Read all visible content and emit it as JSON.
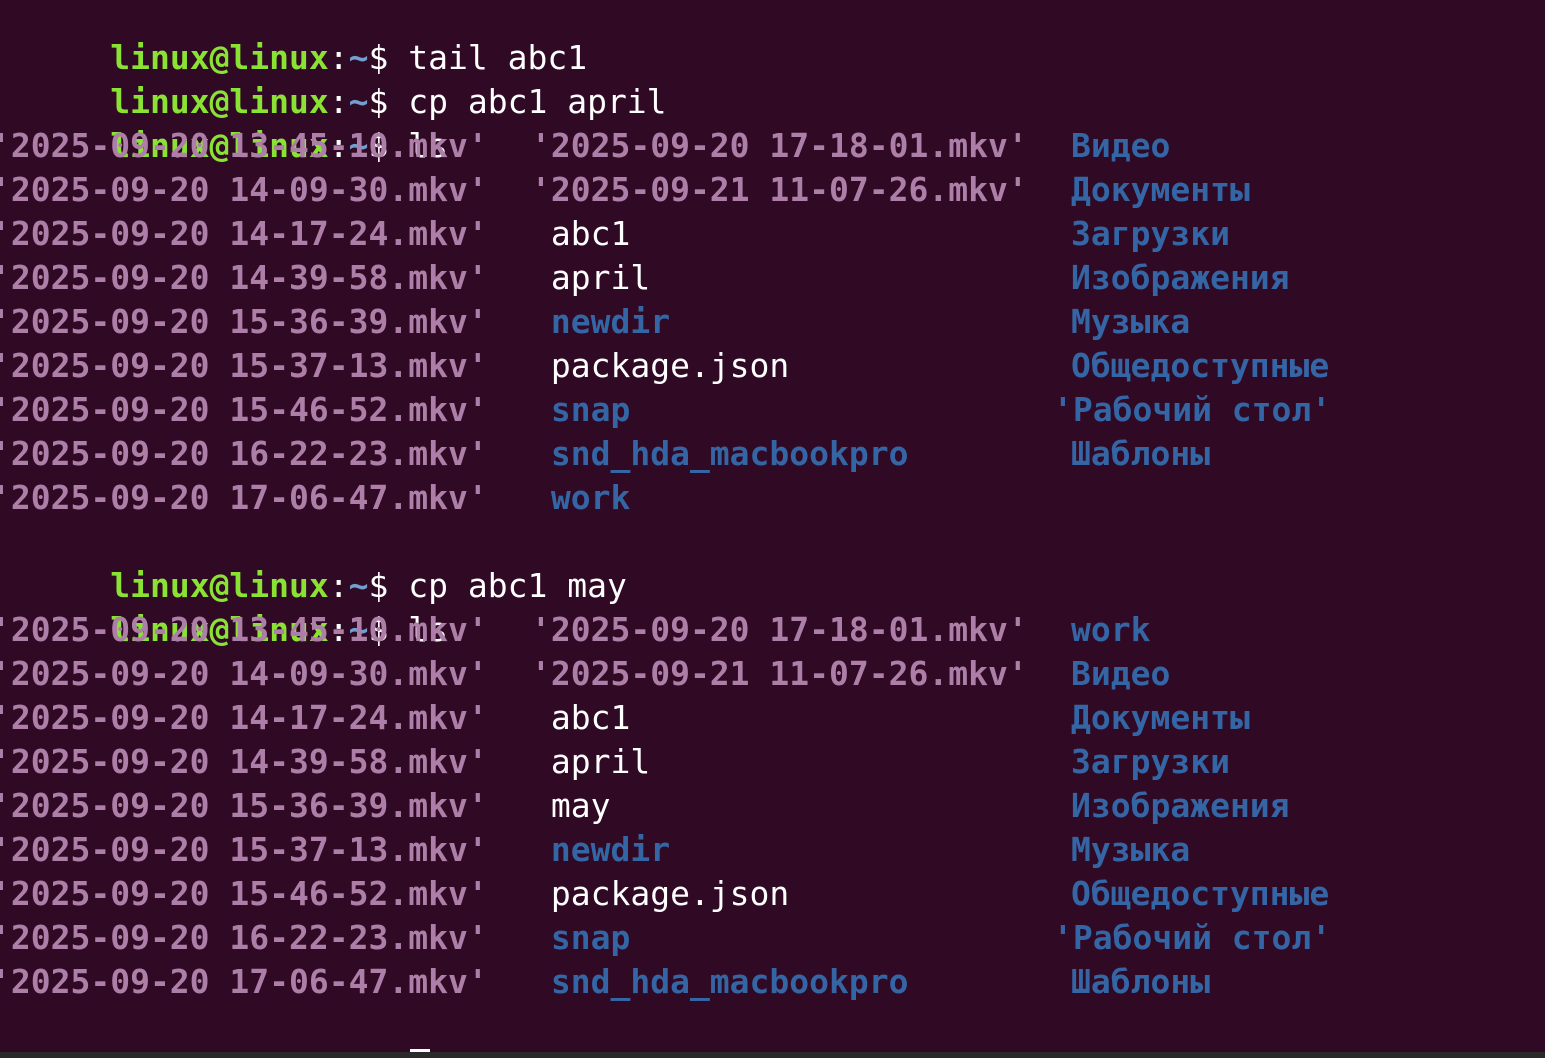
{
  "prompt": {
    "user_host": "linux@linux",
    "colon": ":",
    "path": "~",
    "dollar": "$ "
  },
  "commands": {
    "c1": "tail abc1",
    "c2": "cp abc1 april",
    "c3": "ls",
    "c4": "cp abc1 may",
    "c5": "ls"
  },
  "ls1": [
    [
      "'2025-09-20 13-45-10.mkv'",
      "'2025-09-20 17-18-01.mkv'",
      "Видео"
    ],
    [
      "'2025-09-20 14-09-30.mkv'",
      "'2025-09-21 11-07-26.mkv'",
      "Документы"
    ],
    [
      "'2025-09-20 14-17-24.mkv'",
      " abc1",
      "Загрузки"
    ],
    [
      "'2025-09-20 14-39-58.mkv'",
      " april",
      "Изображения"
    ],
    [
      "'2025-09-20 15-36-39.mkv'",
      " newdir",
      "Музыка"
    ],
    [
      "'2025-09-20 15-37-13.mkv'",
      " package.json",
      "Общедоступные"
    ],
    [
      "'2025-09-20 15-46-52.mkv'",
      " snap",
      "'Рабочий стол'"
    ],
    [
      "'2025-09-20 16-22-23.mkv'",
      " snd_hda_macbookpro",
      "Шаблоны"
    ],
    [
      "'2025-09-20 17-06-47.mkv'",
      " work",
      ""
    ]
  ],
  "ls2": [
    [
      "'2025-09-20 13-45-10.mkv'",
      "'2025-09-20 17-18-01.mkv'",
      "work"
    ],
    [
      "'2025-09-20 14-09-30.mkv'",
      "'2025-09-21 11-07-26.mkv'",
      "Видео"
    ],
    [
      "'2025-09-20 14-17-24.mkv'",
      " abc1",
      "Документы"
    ],
    [
      "'2025-09-20 14-39-58.mkv'",
      " april",
      "Загрузки"
    ],
    [
      "'2025-09-20 15-36-39.mkv'",
      " may",
      "Изображения"
    ],
    [
      "'2025-09-20 15-37-13.mkv'",
      " newdir",
      "Музыка"
    ],
    [
      "'2025-09-20 15-46-52.mkv'",
      " package.json",
      "Общедоступные"
    ],
    [
      "'2025-09-20 16-22-23.mkv'",
      " snap",
      "'Рабочий стол'"
    ],
    [
      "'2025-09-20 17-06-47.mkv'",
      " snd_hda_macbookpro",
      "Шаблоны"
    ]
  ],
  "kinds1": [
    [
      "media",
      "media",
      "dir"
    ],
    [
      "media",
      "media",
      "dir"
    ],
    [
      "media",
      "file",
      "dir"
    ],
    [
      "media",
      "file",
      "dir"
    ],
    [
      "media",
      "dir",
      "dir"
    ],
    [
      "media",
      "file",
      "dir"
    ],
    [
      "media",
      "dir",
      "dir"
    ],
    [
      "media",
      "dir",
      "dir"
    ],
    [
      "media",
      "dir",
      ""
    ]
  ],
  "kinds2": [
    [
      "media",
      "media",
      "dir"
    ],
    [
      "media",
      "media",
      "dir"
    ],
    [
      "media",
      "file",
      "dir"
    ],
    [
      "media",
      "file",
      "dir"
    ],
    [
      "media",
      "file",
      "dir"
    ],
    [
      "media",
      "dir",
      "dir"
    ],
    [
      "media",
      "file",
      "dir"
    ],
    [
      "media",
      "dir",
      "dir"
    ],
    [
      "media",
      "dir",
      "dir"
    ]
  ],
  "colors": {
    "background": "#300a24",
    "prompt_user": "#8ae234",
    "prompt_path": "#729fcf",
    "media_file": "#ad7fa8",
    "directory": "#3465a4",
    "regular_file": "#ffffff"
  }
}
